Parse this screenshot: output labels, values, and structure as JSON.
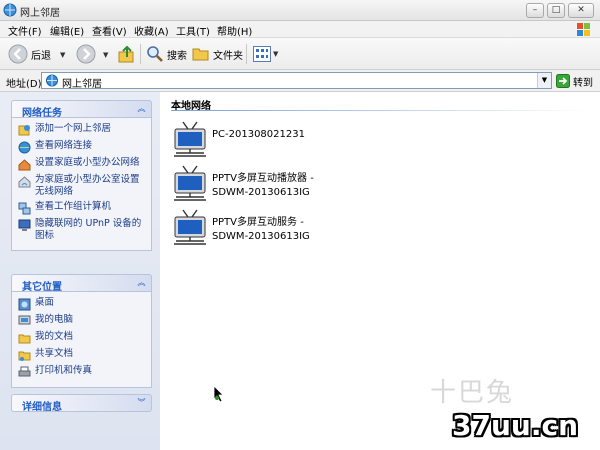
{
  "window": {
    "title": "网上邻居",
    "min_label": "–",
    "max_label": "□",
    "close_label": "✕"
  },
  "menu": [
    "文件(F)",
    "编辑(E)",
    "查看(V)",
    "收藏(A)",
    "工具(T)",
    "帮助(H)"
  ],
  "toolbar": {
    "back_label": "后退",
    "search_label": "搜索",
    "folders_label": "文件夹"
  },
  "address": {
    "label": "地址(D)",
    "value": "网上邻居",
    "go_label": "转到"
  },
  "tasks_panel": {
    "title": "网络任务",
    "items": [
      {
        "label": "添加一个网上邻居",
        "icon": "add-network-place-icon"
      },
      {
        "label": "查看网络连接",
        "icon": "network-connections-icon"
      },
      {
        "label": "设置家庭或小型办公网络",
        "icon": "home-network-icon"
      },
      {
        "label": "为家庭或小型办公室设置无线网络",
        "icon": "wireless-network-icon"
      },
      {
        "label": "查看工作组计算机",
        "icon": "workgroup-computers-icon"
      },
      {
        "label": "隐藏联网的 UPnP 设备的图标",
        "icon": "upnp-device-icon"
      }
    ]
  },
  "places_panel": {
    "title": "其它位置",
    "items": [
      {
        "label": "桌面",
        "icon": "desktop-icon"
      },
      {
        "label": "我的电脑",
        "icon": "my-computer-icon"
      },
      {
        "label": "我的文档",
        "icon": "my-documents-icon"
      },
      {
        "label": "共享文档",
        "icon": "shared-documents-icon"
      },
      {
        "label": "打印机和传真",
        "icon": "printers-icon"
      }
    ]
  },
  "details_panel": {
    "title": "详细信息"
  },
  "content": {
    "group_title": "本地网络",
    "items": [
      {
        "line1": "PC-201308021231",
        "line2": ""
      },
      {
        "line1": "PPTV多屏互动播放器 -",
        "line2": "SDWM-20130613IG"
      },
      {
        "line1": "PPTV多屏互动服务 -",
        "line2": "SDWM-20130613IG"
      }
    ]
  },
  "watermark": {
    "logo_text": "十巴兔",
    "site_text": "37uu.cn"
  }
}
